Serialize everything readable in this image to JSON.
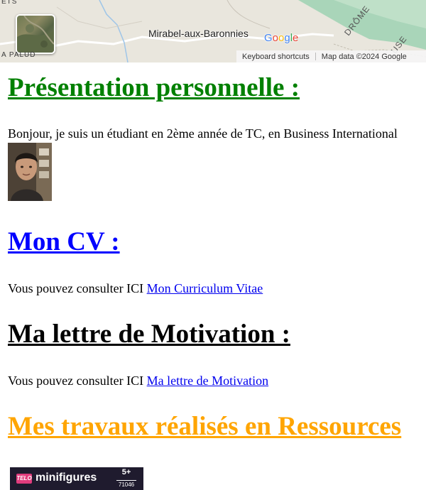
{
  "map": {
    "top_label": "ETS",
    "place_label": "A PALUD",
    "town": "Mirabel-aux-Baronnies",
    "logo_letters": [
      "G",
      "o",
      "o",
      "g",
      "l",
      "e"
    ],
    "logo_colors": [
      "#4285F4",
      "#EA4335",
      "#FBBC05",
      "#4285F4",
      "#34A853",
      "#EA4335"
    ],
    "road_a": "DRÔME",
    "road_b": "USE",
    "footer_shortcuts": "Keyboard shortcuts",
    "footer_data": "Map data ©2024 Google"
  },
  "sections": {
    "presentation": {
      "heading": "Présentation personnelle :",
      "color": "#008000",
      "text": "Bonjour, je suis un étudiant en 2ème année de TC, en Business International"
    },
    "cv": {
      "heading": "Mon CV :",
      "color": "#0000ff",
      "lead": "Vous pouvez consulter ICI ",
      "link_text": "Mon Curriculum Vitae"
    },
    "lettre": {
      "heading": "Ma lettre de Motivation :",
      "color": "#000000",
      "lead": "Vous pouvez consulter ICI ",
      "link_text": "Ma lettre de Motivation"
    },
    "travaux": {
      "heading": "Mes travaux réalisés en Ressources",
      "color": "#ffa500"
    }
  },
  "thumbnail": {
    "badge": "TELO",
    "name": "minifigures",
    "count": "5+",
    "ref": "71046"
  }
}
